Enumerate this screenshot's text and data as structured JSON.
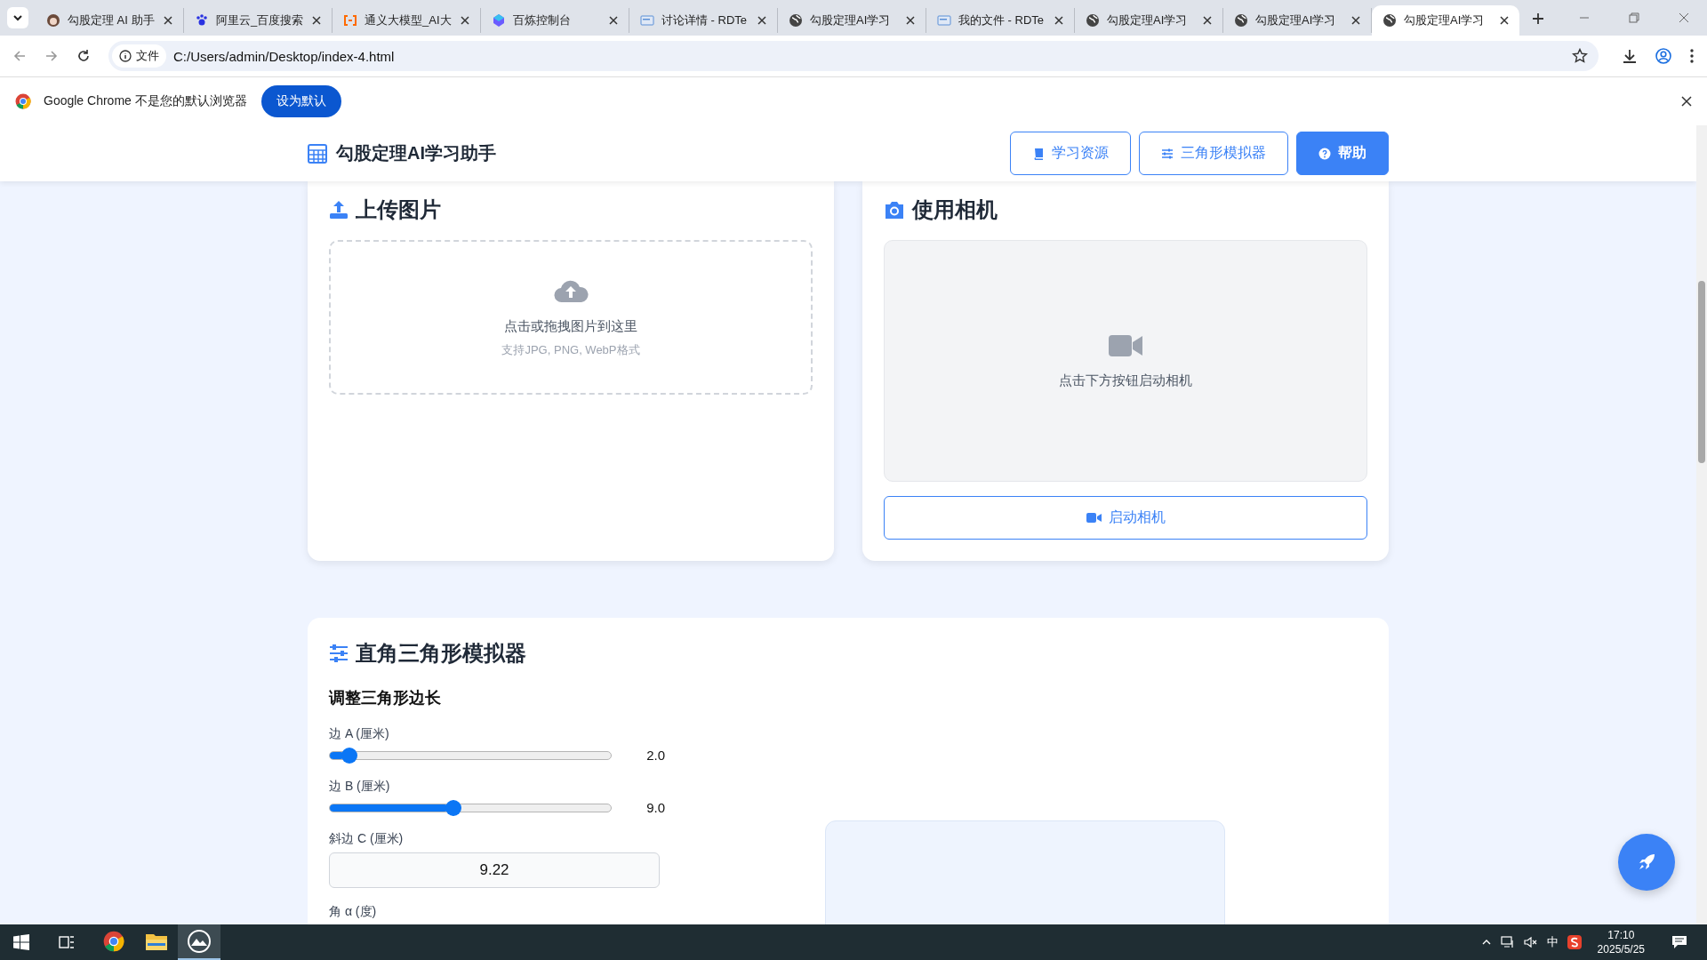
{
  "tabs": [
    {
      "kind": "avatar",
      "title": "勾股定理 AI 助手",
      "selected": false
    },
    {
      "kind": "paw",
      "title": "阿里云_百度搜索",
      "selected": false
    },
    {
      "kind": "bracket",
      "title": "通义大模型_AI大",
      "selected": false
    },
    {
      "kind": "cube",
      "title": "百炼控制台",
      "selected": false
    },
    {
      "kind": "doc",
      "title": "讨论详情 - RDTe",
      "selected": false
    },
    {
      "kind": "globe",
      "title": "勾股定理AI学习",
      "selected": false
    },
    {
      "kind": "doc",
      "title": "我的文件 - RDTe",
      "selected": false
    },
    {
      "kind": "globe",
      "title": "勾股定理AI学习",
      "selected": false
    },
    {
      "kind": "globe",
      "title": "勾股定理AI学习",
      "selected": false
    },
    {
      "kind": "globe",
      "title": "勾股定理AI学习",
      "selected": true
    }
  ],
  "address": {
    "chip": "文件",
    "url": "C:/Users/admin/Desktop/index-4.html"
  },
  "infobar": {
    "message": "Google Chrome 不是您的默认浏览器",
    "button": "设为默认"
  },
  "header": {
    "title": "勾股定理AI学习助手",
    "nav": [
      {
        "label": "学习资源",
        "kind": "book",
        "selected": false
      },
      {
        "label": "三角形模拟器",
        "kind": "sliders",
        "selected": false
      },
      {
        "label": "帮助",
        "kind": "help",
        "selected": true
      }
    ]
  },
  "upload": {
    "title": "上传图片",
    "hint": "点击或拖拽图片到这里",
    "formats": "支持JPG, PNG, WebP格式"
  },
  "camera": {
    "title": "使用相机",
    "hint": "点击下方按钮启动相机",
    "button": "启动相机"
  },
  "simulator": {
    "title": "直角三角形模拟器",
    "subtitle": "调整三角形边长",
    "sliders": [
      {
        "label": "边 A (厘米)",
        "level": 0.05,
        "reading": "2.0"
      },
      {
        "label": "边 B (厘米)",
        "level": 0.42,
        "reading": "9.0"
      }
    ],
    "hypotenuse": {
      "label": "斜边 C (厘米)",
      "value": "9.22"
    },
    "angle_label": "角 α (度)"
  },
  "taskbar": {
    "time": "17:10",
    "date": "2025/5/25",
    "ime": "中"
  }
}
